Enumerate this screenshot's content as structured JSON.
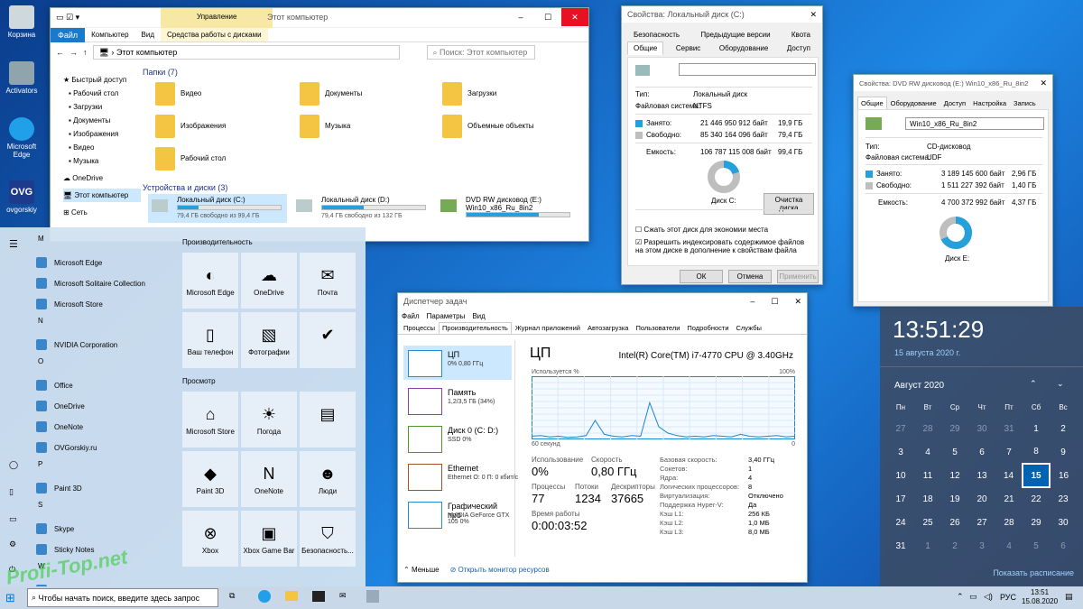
{
  "desktop": {
    "icons": [
      "Корзина",
      "Activators",
      "Microsoft Edge",
      "ovgorskiy"
    ]
  },
  "explorer": {
    "title": "Этот компьютер",
    "ribbon_manage": "Управление",
    "ribbon_tabs": [
      "Файл",
      "Компьютер",
      "Вид",
      "Средства работы с дисками"
    ],
    "address": "Этот компьютер",
    "search": "Поиск: Этот компьютер",
    "nav": [
      "Быстрый доступ",
      "Рабочий стол",
      "Загрузки",
      "Документы",
      "Изображения",
      "Видео",
      "Музыка",
      "OneDrive",
      "Этот компьютер",
      "Сеть"
    ],
    "folders_header": "Папки (7)",
    "folders": [
      "Видео",
      "Документы",
      "Загрузки",
      "Изображения",
      "Музыка",
      "Объемные объекты",
      "Рабочий стол"
    ],
    "devices_header": "Устройства и диски (3)",
    "drives": [
      {
        "name": "Локальный диск (C:)",
        "free": "79,4 ГБ свободно из 99,4 ГБ",
        "fill": 0.2
      },
      {
        "name": "Локальный диск (D:)",
        "free": "79,4 ГБ свободно из 132 ГБ",
        "fill": 0.4
      },
      {
        "name": "DVD RW дисковод (E:)",
        "sub": "Win10_x86_Ru_8in2",
        "fill": 0.7
      }
    ]
  },
  "propsC": {
    "title": "Свойства: Локальный диск (C:)",
    "tabs_top": [
      "Безопасность",
      "Предыдущие версии",
      "Квота"
    ],
    "tabs_bot": [
      "Общие",
      "Сервис",
      "Оборудование",
      "Доступ"
    ],
    "type_l": "Тип:",
    "type_v": "Локальный диск",
    "fs_l": "Файловая система:",
    "fs_v": "NTFS",
    "used_l": "Занято:",
    "used_b": "21 446 950 912 байт",
    "used_g": "19,9 ГБ",
    "free_l": "Свободно:",
    "free_b": "85 340 164 096 байт",
    "free_g": "79,4 ГБ",
    "cap_l": "Емкость:",
    "cap_b": "106 787 115 008 байт",
    "cap_g": "99,4 ГБ",
    "disk": "Диск C:",
    "clean": "Очистка диска",
    "cb1": "Сжать этот диск для экономии места",
    "cb2": "Разрешить индексировать содержимое файлов на этом диске в дополнение к свойствам файла",
    "ok": "ОК",
    "cancel": "Отмена",
    "apply": "Применить",
    "used_frac": 0.2
  },
  "propsE": {
    "title": "Свойства: DVD RW дисковод (E:) Win10_x86_Ru_8in2",
    "tabs": [
      "Общие",
      "Оборудование",
      "Доступ",
      "Настройка",
      "Запись"
    ],
    "label": "Win10_x86_Ru_8in2",
    "type_l": "Тип:",
    "type_v": "CD-дисковод",
    "fs_l": "Файловая система:",
    "fs_v": "UDF",
    "used_l": "Занято:",
    "used_b": "3 189 145 600 байт",
    "used_g": "2,96 ГБ",
    "free_l": "Свободно:",
    "free_b": "1 511 227 392 байт",
    "free_g": "1,40 ГБ",
    "cap_l": "Емкость:",
    "cap_b": "4 700 372 992 байт",
    "cap_g": "4,37 ГБ",
    "disk": "Диск E:",
    "used_frac": 0.68
  },
  "taskmgr": {
    "title": "Диспетчер задач",
    "menu": [
      "Файл",
      "Параметры",
      "Вид"
    ],
    "tabs": [
      "Процессы",
      "Производительность",
      "Журнал приложений",
      "Автозагрузка",
      "Пользователи",
      "Подробности",
      "Службы"
    ],
    "side": [
      {
        "t1": "ЦП",
        "t2": "0% 0,80 ГГц"
      },
      {
        "t1": "Память",
        "t2": "1,2/3,5 ГБ (34%)"
      },
      {
        "t1": "Диск 0 (C: D:)",
        "t2": "SSD 0%"
      },
      {
        "t1": "Ethernet",
        "t2": "Ethernet О: 0 П: 0 кбит/с"
      },
      {
        "t1": "Графический про",
        "t2": "NVIDIA GeForce GTX 105 0%"
      }
    ],
    "head": "ЦП",
    "cpu": "Intel(R) Core(TM) i7-4770 CPU @ 3.40GHz",
    "usage_l": "Используется %",
    "pct": "100%",
    "sec": "60 секунд",
    "zero": "0",
    "use_l": "Использование",
    "use_v": "0%",
    "spd_l": "Скорость",
    "spd_v": "0,80 ГГц",
    "proc_l": "Процессы",
    "proc_v": "77",
    "thr_l": "Потоки",
    "thr_v": "1234",
    "desc_l": "Дескрипторы",
    "desc_v": "37665",
    "up_l": "Время работы",
    "up_v": "0:00:03:52",
    "specs": [
      [
        "Базовая скорость:",
        "3,40 ГГц"
      ],
      [
        "Сокетов:",
        "1"
      ],
      [
        "Ядра:",
        "4"
      ],
      [
        "Логических процессоров:",
        "8"
      ],
      [
        "Виртуализация:",
        "Отключено"
      ],
      [
        "Поддержка Hyper-V:",
        "Да"
      ],
      [
        "Кэш L1:",
        "256 КБ"
      ],
      [
        "Кэш L2:",
        "1,0 МБ"
      ],
      [
        "Кэш L3:",
        "8,0 МБ"
      ]
    ],
    "less": "Меньше",
    "resmon": "Открыть монитор ресурсов",
    "graph": [
      5,
      6,
      4,
      5,
      3,
      4,
      6,
      30,
      8,
      5,
      4,
      6,
      5,
      58,
      20,
      10,
      6,
      4,
      5,
      4,
      6,
      5,
      4,
      8,
      5,
      4,
      5,
      6,
      4,
      5
    ]
  },
  "start": {
    "letters": [
      "M",
      "N",
      "O",
      "P",
      "S",
      "W"
    ],
    "apps": [
      "Microsoft Edge",
      "Microsoft Solitaire Collection",
      "Microsoft Store",
      "NVIDIA Corporation",
      "Office",
      "OneDrive",
      "OneNote",
      "OVGorskiy.ru",
      "Paint 3D",
      "Skype",
      "Sticky Notes",
      "Windows PowerShell"
    ],
    "sec1": "Производительность",
    "sec2": "Просмотр",
    "tiles": [
      "Microsoft Edge",
      "OneDrive",
      "Почта",
      "Ваш телефон",
      "Фотографии",
      "",
      "Microsoft Store",
      "Погода",
      "",
      "Paint 3D",
      "OneNote",
      "Люди",
      "Xbox",
      "Xbox Game Bar",
      "Безопасность..."
    ]
  },
  "clock": {
    "time": "13:51:29",
    "date": "15 августа 2020 г.",
    "month": "Август 2020",
    "days": [
      "Пн",
      "Вт",
      "Ср",
      "Чт",
      "Пт",
      "Сб",
      "Вс"
    ],
    "weeks": [
      [
        "27",
        "28",
        "29",
        "30",
        "31",
        "1",
        "2"
      ],
      [
        "3",
        "4",
        "5",
        "6",
        "7",
        "8",
        "9"
      ],
      [
        "10",
        "11",
        "12",
        "13",
        "14",
        "15",
        "16"
      ],
      [
        "17",
        "18",
        "19",
        "20",
        "21",
        "22",
        "23"
      ],
      [
        "24",
        "25",
        "26",
        "27",
        "28",
        "29",
        "30"
      ],
      [
        "31",
        "1",
        "2",
        "3",
        "4",
        "5",
        "6"
      ]
    ],
    "schedule": "Показать расписание"
  },
  "taskbar": {
    "search": "Чтобы начать поиск, введите здесь запрос",
    "lang": "РУС",
    "time": "13:51",
    "date": "15.08.2020"
  },
  "watermark": "Profi-Top.net"
}
